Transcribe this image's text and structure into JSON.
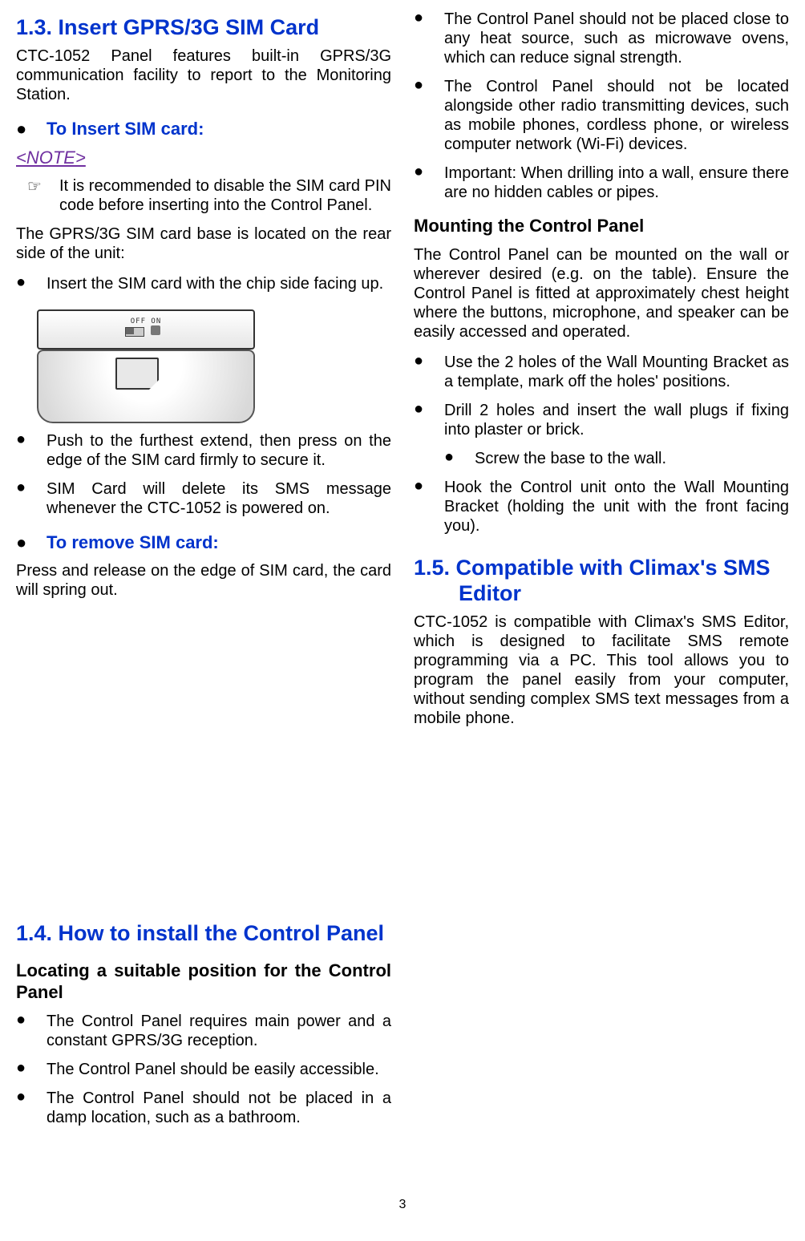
{
  "section13": {
    "title": "1.3. Insert GPRS/3G SIM Card",
    "intro": "CTC-1052 Panel features built-in GPRS/3G communication facility to report to the Monitoring Station.",
    "insert_heading": "To Insert SIM card:",
    "note_label": "<NOTE>",
    "note_text": "It is recommended to disable the SIM card PIN code before inserting into the Control Panel.",
    "base_location": "The GPRS/3G SIM card base is located on the rear side of the unit:",
    "img_label": "OFF ON",
    "steps": [
      "Insert the SIM card with the chip side facing up.",
      "Push to the furthest extend, then press on the edge of the SIM card firmly to secure it.",
      "SIM Card will delete its SMS message whenever the CTC-1052 is powered on."
    ],
    "remove_heading": "To remove SIM card:",
    "remove_text": "Press and release on the edge of SIM card, the card will spring out."
  },
  "section14": {
    "title": "1.4. How to install the Control Panel",
    "locating_heading": "Locating a suitable position for the Control Panel",
    "locating_items": [
      "The Control Panel requires main power and a constant GPRS/3G reception.",
      "The Control Panel should be easily accessible.",
      "The Control Panel should not be placed in a damp location, such as a bathroom.",
      "The Control Panel should not be placed close to any heat source, such as microwave ovens, which can reduce signal strength.",
      "The Control Panel should not be located alongside other radio transmitting devices, such as mobile phones, cordless phone, or wireless computer network (Wi-Fi) devices.",
      "Important: When drilling into a wall, ensure there are no hidden cables or pipes."
    ],
    "mounting_heading": "Mounting the Control Panel",
    "mounting_intro": "The Control Panel can be mounted on the wall or wherever desired (e.g. on the table).  Ensure the Control Panel is fitted at approximately chest height where the buttons, microphone, and speaker can be easily accessed and operated.",
    "mounting_items": [
      "Use the 2 holes of the Wall Mounting Bracket as a template, mark off the holes' positions.",
      "Drill 2 holes and insert the wall plugs if fixing into plaster or brick."
    ],
    "mounting_sub": "Screw the base to the wall.",
    "mounting_item_last": "Hook the Control unit onto the Wall Mounting Bracket (holding the unit with the front facing you)."
  },
  "section15": {
    "title": "1.5. Compatible with Climax's SMS Editor",
    "body": "CTC-1052 is compatible with Climax's SMS Editor, which is designed to facilitate SMS remote programming via a PC. This tool allows you to program the panel easily from your computer, without sending complex SMS text messages from a mobile phone."
  },
  "page_number": "3"
}
